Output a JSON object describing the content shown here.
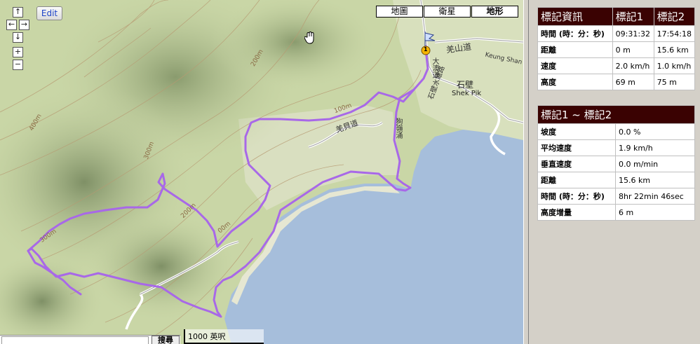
{
  "map": {
    "edit_label": "Edit",
    "nav": {
      "up": "↑",
      "left": "←",
      "right": "→",
      "down": "↓",
      "zoom_in": "+",
      "zoom_out": "−"
    },
    "map_types": [
      {
        "label": "地圖",
        "active": false
      },
      {
        "label": "衛星",
        "active": false
      },
      {
        "label": "地形",
        "active": true
      }
    ],
    "labels": {
      "road_qiang": "羌山道",
      "road_keung": "Keung Shan R",
      "village_zh": "石壁",
      "village_en": "Shek Pik",
      "road_shui": "大澳道",
      "road_shek": "石壁水塘路",
      "road_ngo": "狗嶺涌",
      "road_lantau": "羌貝道",
      "contour_200a": "200m",
      "contour_400": "400m",
      "contour_300a": "300m",
      "contour_100": "100m",
      "contour_200b": "200m",
      "contour_100b": "00m",
      "contour_300b": "300m"
    },
    "marker_start": "1",
    "scale": "1000 英呎",
    "search_button": "搜尋",
    "colors": {
      "track": "#a868e8",
      "water": "#a6bedb",
      "land": "#c9d6a6"
    }
  },
  "marker_info": {
    "header": [
      "標記資訊",
      "標記1",
      "標記2"
    ],
    "rows": [
      {
        "label": "時間 (時：分：秒)",
        "m1": "09:31:32",
        "m2": "17:54:18"
      },
      {
        "label": "距離",
        "m1": "0 m",
        "m2": "15.6 km"
      },
      {
        "label": "速度",
        "m1": "2.0 km/h",
        "m2": "1.0 km/h"
      },
      {
        "label": "高度",
        "m1": "69 m",
        "m2": "75 m"
      }
    ]
  },
  "segment_info": {
    "header": "標記1 ~ 標記2",
    "rows": [
      {
        "label": "坡度",
        "value": "0.0 %"
      },
      {
        "label": "平均速度",
        "value": "1.9 km/h"
      },
      {
        "label": "垂直速度",
        "value": "0.0 m/min"
      },
      {
        "label": "距離",
        "value": "15.6 km"
      },
      {
        "label": "時間 (時：分：秒)",
        "value": "8hr 22min 46sec"
      },
      {
        "label": "高度增量",
        "value": "6 m"
      }
    ]
  }
}
